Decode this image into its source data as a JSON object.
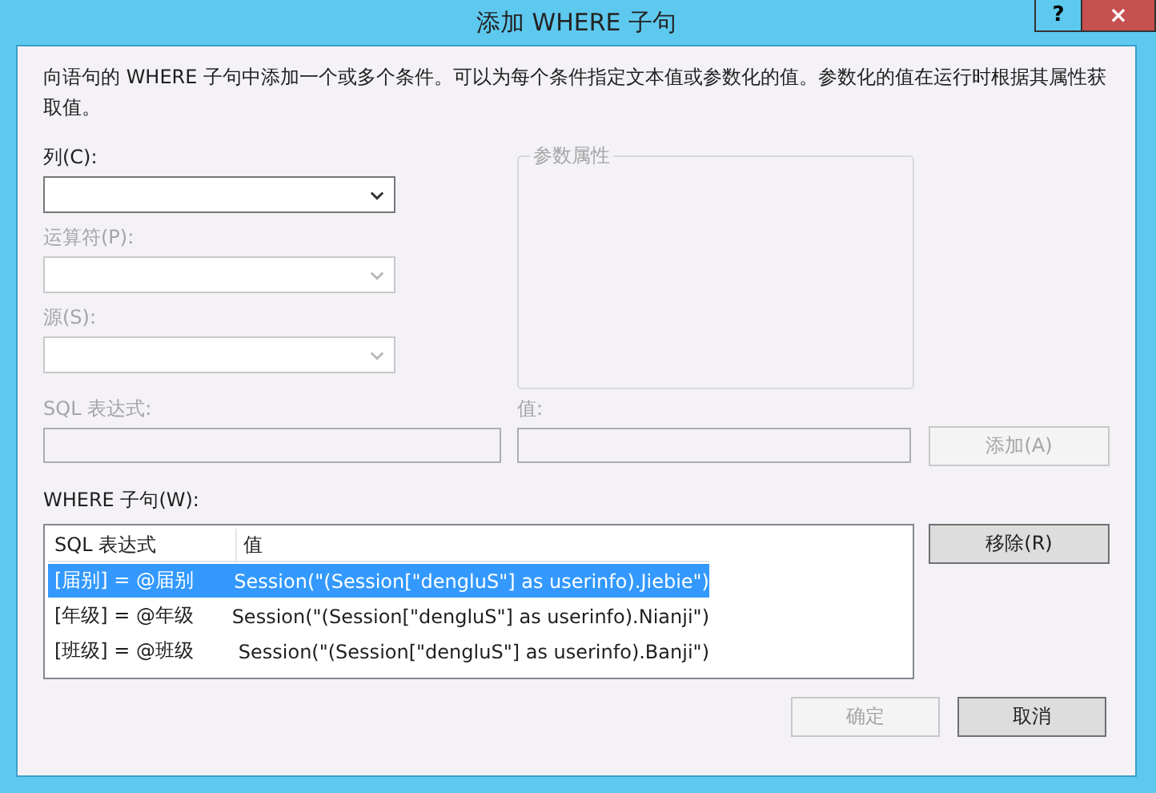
{
  "window": {
    "title": "添加 WHERE 子句",
    "help_button": "?",
    "close_button": "×"
  },
  "description": "向语句的 WHERE 子句中添加一个或多个条件。可以为每个条件指定文本值或参数化的值。参数化的值在运行时根据其属性获取值。",
  "dropdowns": [
    {
      "label": "列(C):",
      "disabled": false
    },
    {
      "label": "运算符(P):",
      "disabled": true
    },
    {
      "label": "源(S):",
      "disabled": true
    }
  ],
  "parameter_group": {
    "title": "参数属性",
    "disabled": true
  },
  "sql_field": {
    "label": "SQL 表达式:",
    "disabled": true
  },
  "value_field": {
    "label": "值:",
    "disabled": true
  },
  "add_button": {
    "label": "添加(A)",
    "disabled": true
  },
  "where_list": {
    "label": "WHERE 子句(W):",
    "columns": [
      "SQL 表达式",
      "值"
    ],
    "rows": [
      {
        "expression": "[届别] = @届别",
        "value": "Session(\"(Session[\"dengluS\"] as userinfo).Jiebie\")",
        "selected": true
      },
      {
        "expression": "[年级] = @年级",
        "value": "Session(\"(Session[\"dengluS\"] as userinfo).Nianji\")",
        "selected": false
      },
      {
        "expression": "[班级] = @班级",
        "value": "Session(\"(Session[\"dengluS\"] as userinfo).Banji\")",
        "selected": false
      }
    ]
  },
  "remove_button": {
    "label": "移除(R)",
    "disabled": false
  },
  "buttons": [
    {
      "label": "确定",
      "disabled": true
    },
    {
      "label": "取消",
      "disabled": false
    }
  ]
}
